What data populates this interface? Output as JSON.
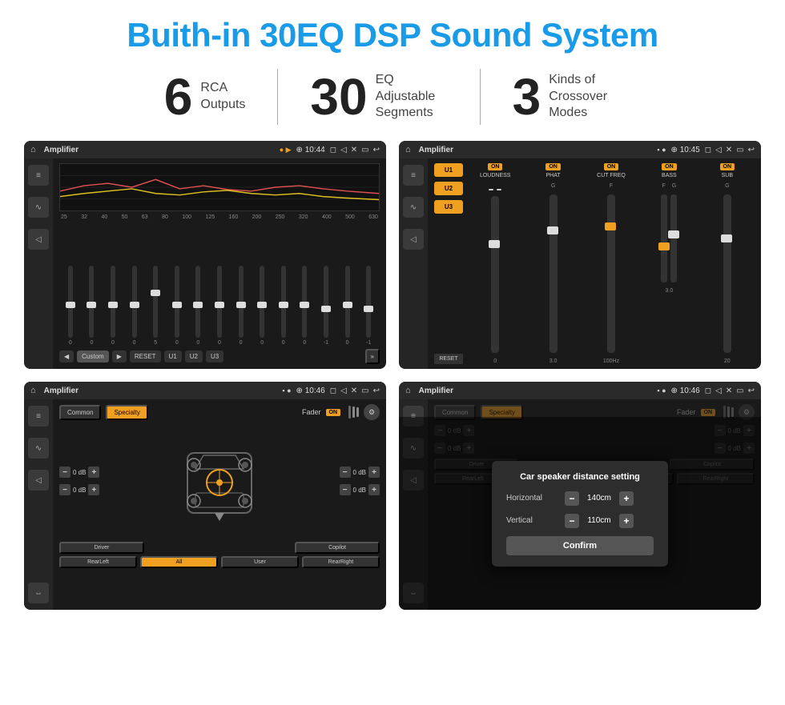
{
  "title": "Buith-in 30EQ DSP Sound System",
  "stats": [
    {
      "number": "6",
      "text": "RCA\nOutputs"
    },
    {
      "number": "30",
      "text": "EQ Adjustable\nSegments"
    },
    {
      "number": "3",
      "text": "Kinds of\nCrossover Modes"
    }
  ],
  "screens": [
    {
      "id": "eq-screen",
      "topbar": {
        "icon": "home",
        "title": "Amplifier",
        "time": "10:44"
      },
      "type": "eq"
    },
    {
      "id": "amp2-screen",
      "topbar": {
        "icon": "home",
        "title": "Amplifier",
        "time": "10:45"
      },
      "type": "amp2"
    },
    {
      "id": "fader-screen",
      "topbar": {
        "icon": "home",
        "title": "Amplifier",
        "time": "10:46"
      },
      "type": "fader"
    },
    {
      "id": "dialog-screen",
      "topbar": {
        "icon": "home",
        "title": "Amplifier",
        "time": "10:46"
      },
      "type": "dialog"
    }
  ],
  "eq": {
    "freq_labels": [
      "25",
      "32",
      "40",
      "50",
      "63",
      "80",
      "100",
      "125",
      "160",
      "200",
      "250",
      "320",
      "400",
      "500",
      "630"
    ],
    "values": [
      "0",
      "0",
      "0",
      "0",
      "5",
      "0",
      "0",
      "0",
      "0",
      "0",
      "0",
      "0",
      "-1",
      "0",
      "-1"
    ],
    "buttons": [
      "◀",
      "Custom",
      "▶",
      "RESET",
      "U1",
      "U2",
      "U3"
    ]
  },
  "amp2": {
    "presets": [
      "U1",
      "U2",
      "U3"
    ],
    "reset_label": "RESET",
    "channels": [
      {
        "name": "LOUDNESS",
        "on": true
      },
      {
        "name": "PHAT",
        "on": true
      },
      {
        "name": "CUT FREQ",
        "on": true
      },
      {
        "name": "BASS",
        "on": true
      },
      {
        "name": "SUB",
        "on": true
      }
    ]
  },
  "fader": {
    "tabs": [
      "Common",
      "Specialty"
    ],
    "fader_label": "Fader",
    "on_label": "ON",
    "db_values": [
      "0 dB",
      "0 dB",
      "0 dB",
      "0 dB"
    ],
    "bottom_btns": [
      "Driver",
      "",
      "Copilot",
      "RearLeft",
      "All",
      "",
      "User",
      "RearRight"
    ]
  },
  "dialog": {
    "title": "Car speaker distance setting",
    "horizontal_label": "Horizontal",
    "horizontal_value": "140cm",
    "vertical_label": "Vertical",
    "vertical_value": "110cm",
    "confirm_label": "Confirm",
    "db_values": [
      "0 dB",
      "0 dB"
    ],
    "fader_label": "Fader",
    "on_label": "ON"
  }
}
